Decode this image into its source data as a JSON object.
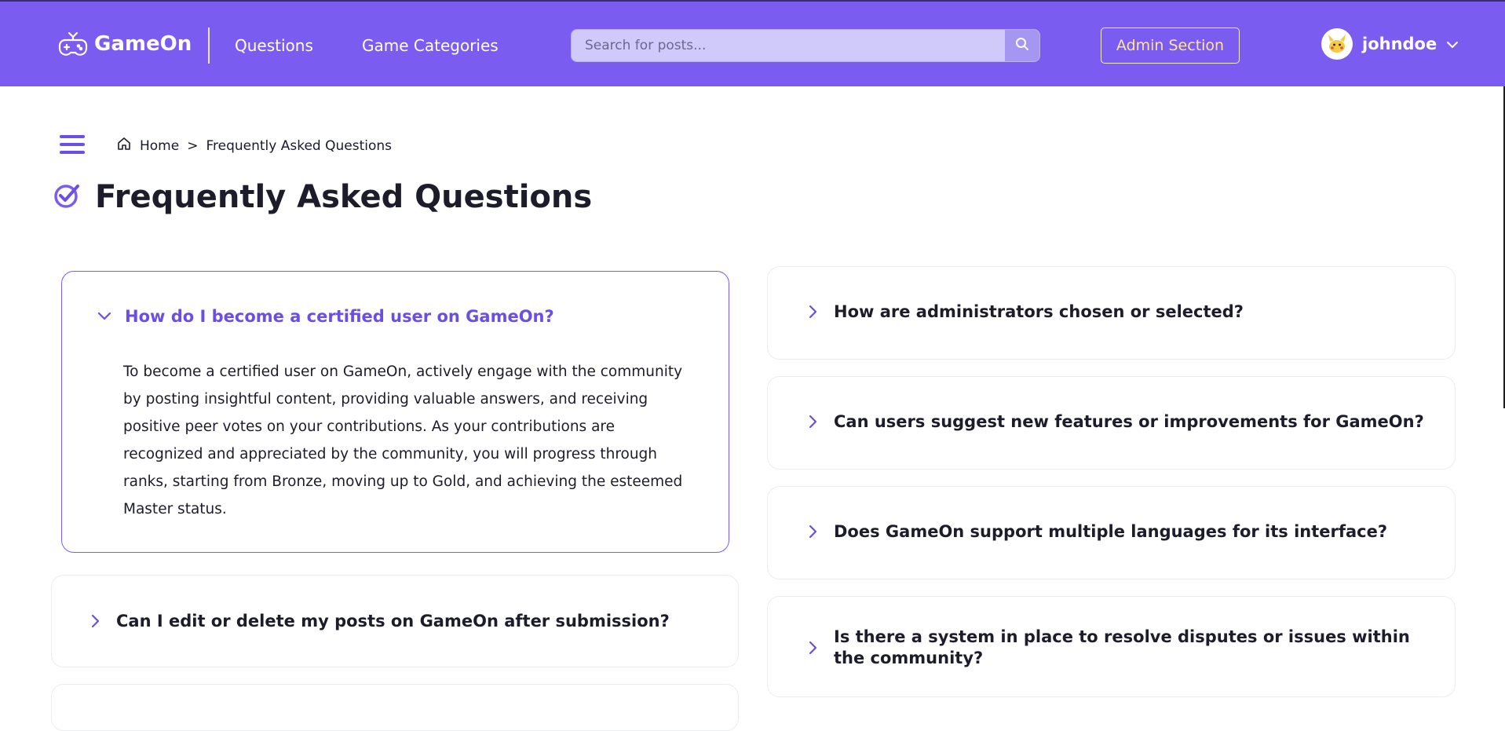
{
  "header": {
    "logo_text": "GameOn",
    "nav": [
      "Questions",
      "Game Categories"
    ],
    "search_placeholder": "Search for posts...",
    "admin_label": "Admin Section",
    "username": "johndoe",
    "accent": "#7b5cf0"
  },
  "breadcrumb": {
    "home": "Home",
    "separator": ">",
    "current": "Frequently Asked Questions"
  },
  "page_title": "Frequently Asked Questions",
  "faqs": [
    {
      "question": "How do I become a certified user on GameOn?",
      "answer": "To become a certified user on GameOn, actively engage with the community by posting insightful content, providing valuable answers, and receiving positive peer votes on your contributions. As your contributions are recognized and appreciated by the community, you will progress through ranks, starting from Bronze, moving up to Gold, and achieving the esteemed Master status.",
      "expanded": true
    },
    {
      "question": "Can I edit or delete my posts on GameOn after submission?",
      "expanded": false
    },
    {
      "question": "How are administrators chosen or selected?",
      "expanded": false
    },
    {
      "question": "Can users suggest new features or improvements for GameOn?",
      "expanded": false
    },
    {
      "question": "Does GameOn support multiple languages for its interface?",
      "expanded": false
    },
    {
      "question": "Is there a system in place to resolve disputes or issues within the community?",
      "expanded": false
    }
  ]
}
